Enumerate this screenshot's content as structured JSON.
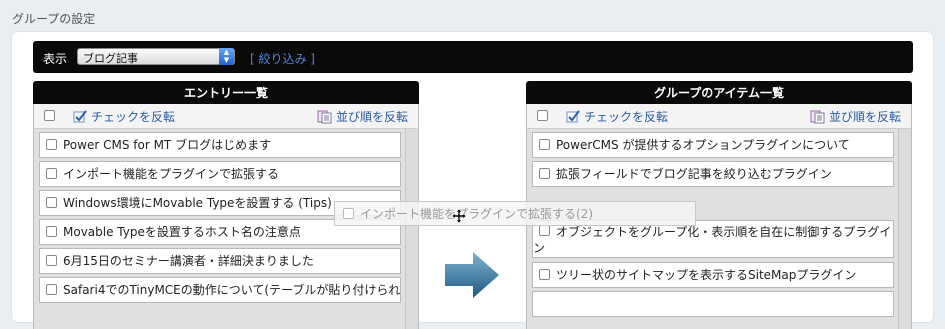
{
  "page_title": "グループの設定",
  "filter": {
    "label": "表示",
    "selected": "ブログ記事",
    "link": "[ 絞り込み ]"
  },
  "left_panel": {
    "title": "エントリー一覧",
    "invert_check_label": "チェックを反転",
    "reverse_order_label": "並び順を反転",
    "items": [
      "Power CMS for MT ブログはじめます",
      "インポート機能をプラグインで拡張する",
      "Windows環境にMovable Typeを設置する (Tips)",
      "Movable Typeを設置するホスト名の注意点",
      "6月15日のセミナー講演者・詳細決まりました",
      "Safari4でのTinyMCEの動作について(テーブルが貼り付けられ"
    ]
  },
  "right_panel": {
    "title": "グループのアイテム一覧",
    "invert_check_label": "チェックを反転",
    "reverse_order_label": "並び順を反転",
    "items": [
      "PowerCMS が提供するオプションプラグインについて",
      "拡張フィールドでブログ記事を絞り込むプラグイン",
      "オブジェクトをグループ化・表示順を自在に制御するプラグイン",
      "ツリー状のサイトマップを表示するSiteMapプラグイン"
    ]
  },
  "drag_ghost": {
    "label": "インポート機能をプラグインで拡張する(2)"
  },
  "colors": {
    "header_bg": "#0a0a0a",
    "link": "#4a86d9",
    "toolbar_link": "#2b5aa8",
    "arrow": "#2e6f95"
  }
}
